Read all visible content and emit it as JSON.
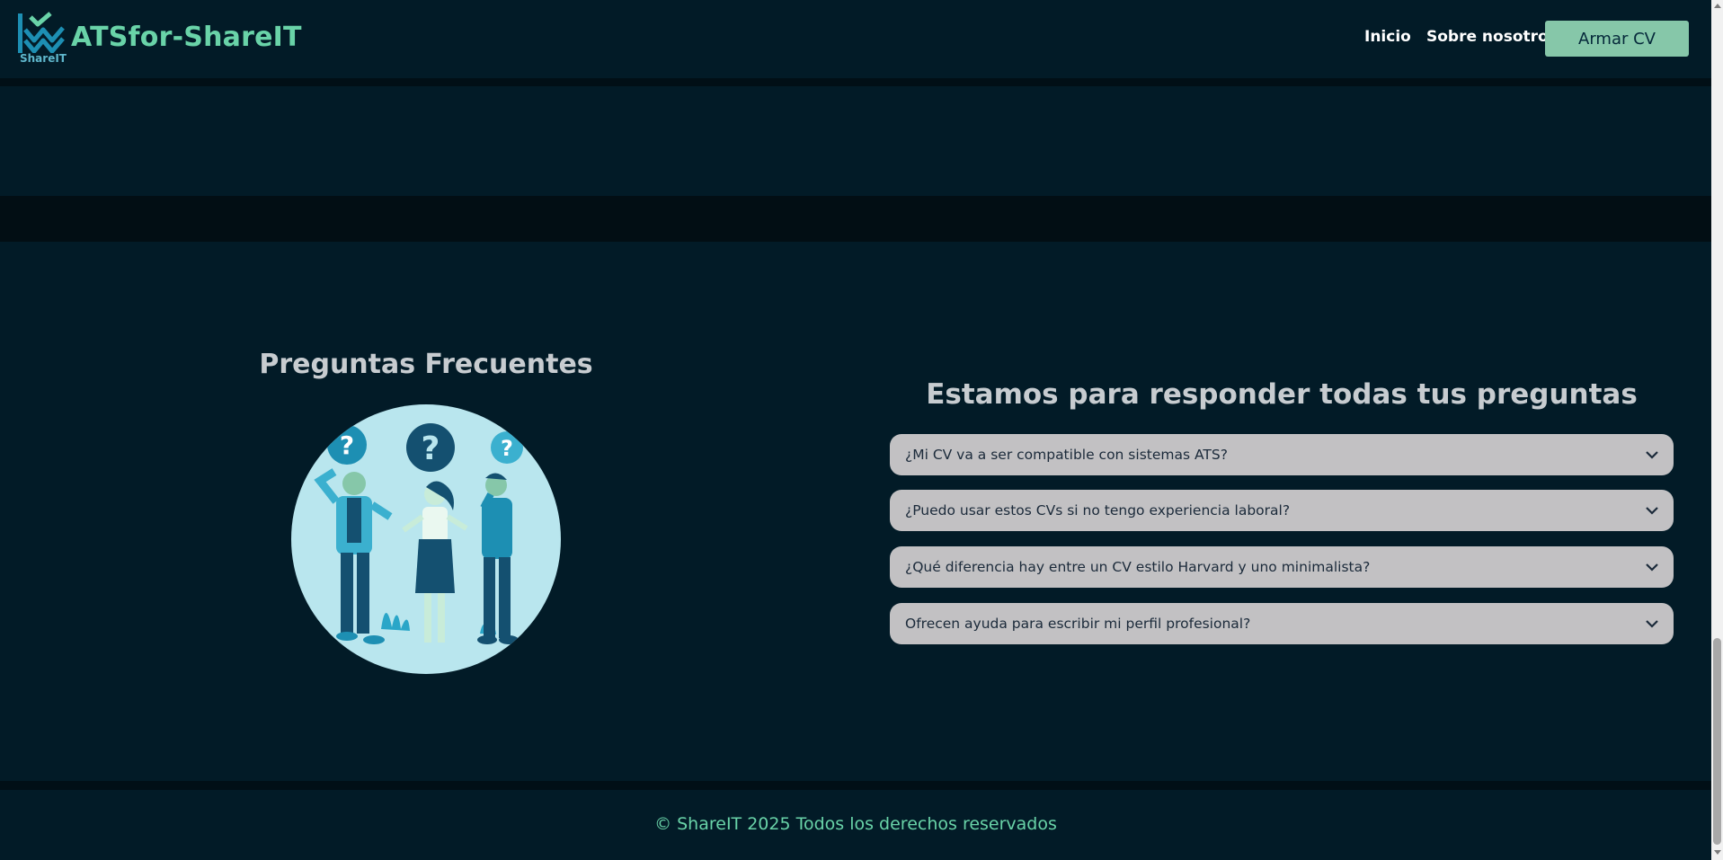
{
  "header": {
    "brand": "ATSfor-ShareIT",
    "logo_sub": "ShareIT",
    "nav": [
      {
        "label": "Inicio"
      },
      {
        "label": "Sobre nosotros"
      }
    ],
    "cta_label": "Armar CV"
  },
  "faq": {
    "left_title": "Preguntas Frecuentes",
    "right_title": "Estamos para responder todas tus preguntas",
    "items": [
      {
        "question": "¿Mi CV va a ser compatible con sistemas ATS?"
      },
      {
        "question": "¿Puedo usar estos CVs si no tengo experiencia laboral?"
      },
      {
        "question": "¿Qué diferencia hay entre un CV estilo Harvard y uno minimalista?"
      },
      {
        "question": "Ofrecen ayuda para escribir mi perfil profesional?"
      }
    ]
  },
  "footer": {
    "text": "© ShareIT 2025 Todos los derechos reservados"
  },
  "colors": {
    "background": "#021b27",
    "accent_green": "#69d3a8",
    "cta_bg": "#86c7a9",
    "faq_item_bg": "#c2c1c3"
  },
  "icons": {
    "logo": "sharelt-logo-icon",
    "chevron": "chevron-down-icon"
  }
}
